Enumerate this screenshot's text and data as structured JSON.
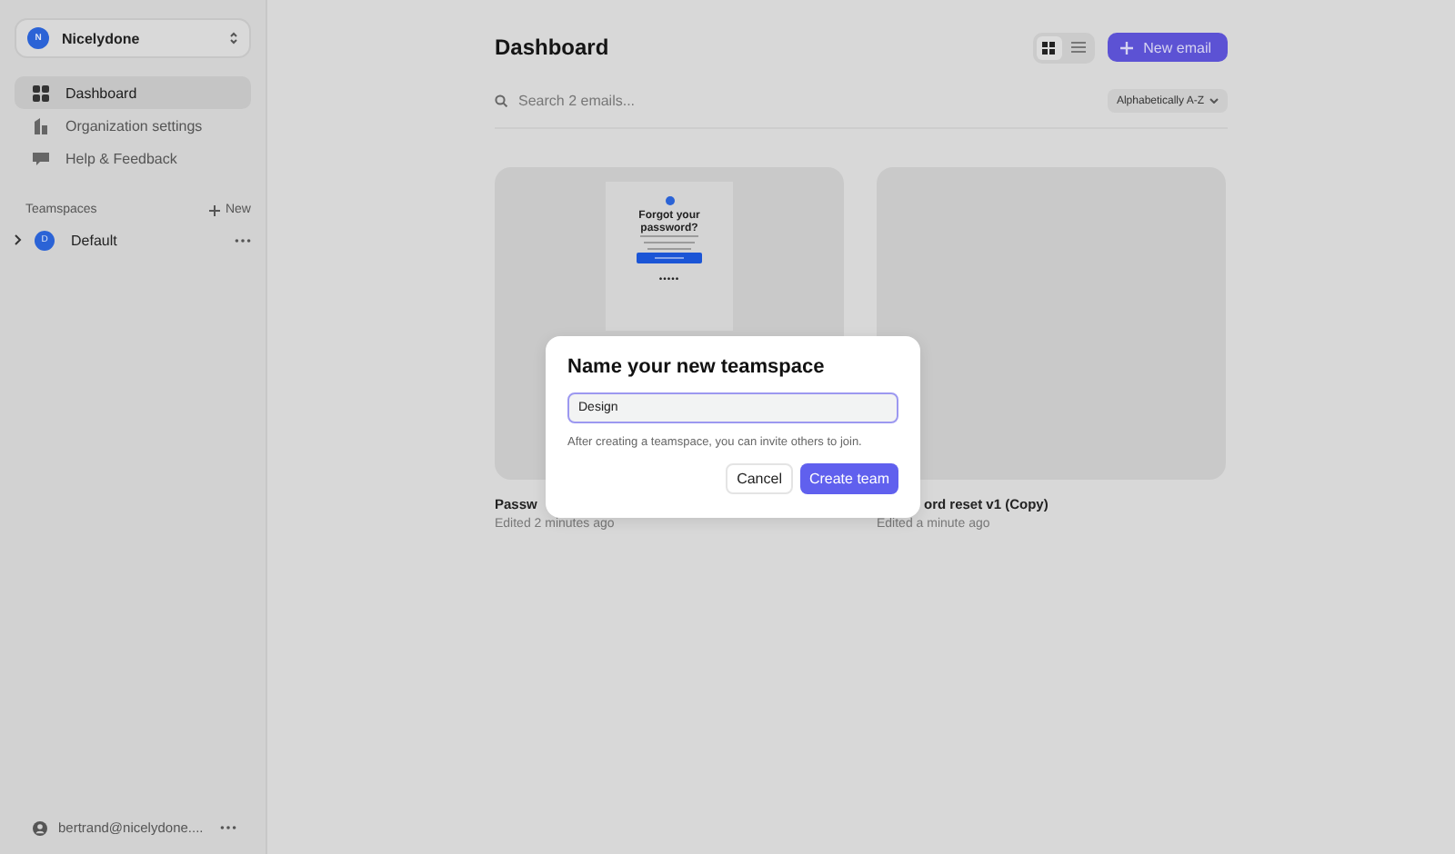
{
  "workspace": {
    "avatar": "N",
    "name": "Nicelydone"
  },
  "nav": [
    {
      "label": "Dashboard",
      "kind": "grid",
      "selected": true
    },
    {
      "label": "Organization settings",
      "kind": "building",
      "selected": false
    },
    {
      "label": "Help & Feedback",
      "kind": "chat",
      "selected": false
    }
  ],
  "teamspaces": {
    "title": "Teamspaces",
    "new_label": "New",
    "items": [
      {
        "avatar": "D",
        "name": "Default",
        "expanded": false
      }
    ]
  },
  "user": {
    "email": "bertrand@nicelydone...."
  },
  "header": {
    "title": "Dashboard",
    "views": [
      {
        "kind": "grid",
        "selected": true
      },
      {
        "kind": "list",
        "selected": false
      }
    ],
    "new_button": "New email"
  },
  "search": {
    "placeholder": "Search 2 emails..."
  },
  "sort": {
    "label": "Alphabetically A-Z"
  },
  "cards": [
    {
      "kind": "preview",
      "preview_heading": "Forgot your password?",
      "preview_dots": "•••••",
      "title": "Passw",
      "subtitle": "Edited 2 minutes ago"
    },
    {
      "kind": "empty",
      "title": "ord reset v1 (Copy)",
      "subtitle": "Edited a minute ago"
    }
  ],
  "dialog": {
    "title": "Name your new teamspace",
    "value": "Design",
    "hint": "After creating a teamspace, you can invite others to join.",
    "cancel": "Cancel",
    "confirm": "Create team"
  }
}
